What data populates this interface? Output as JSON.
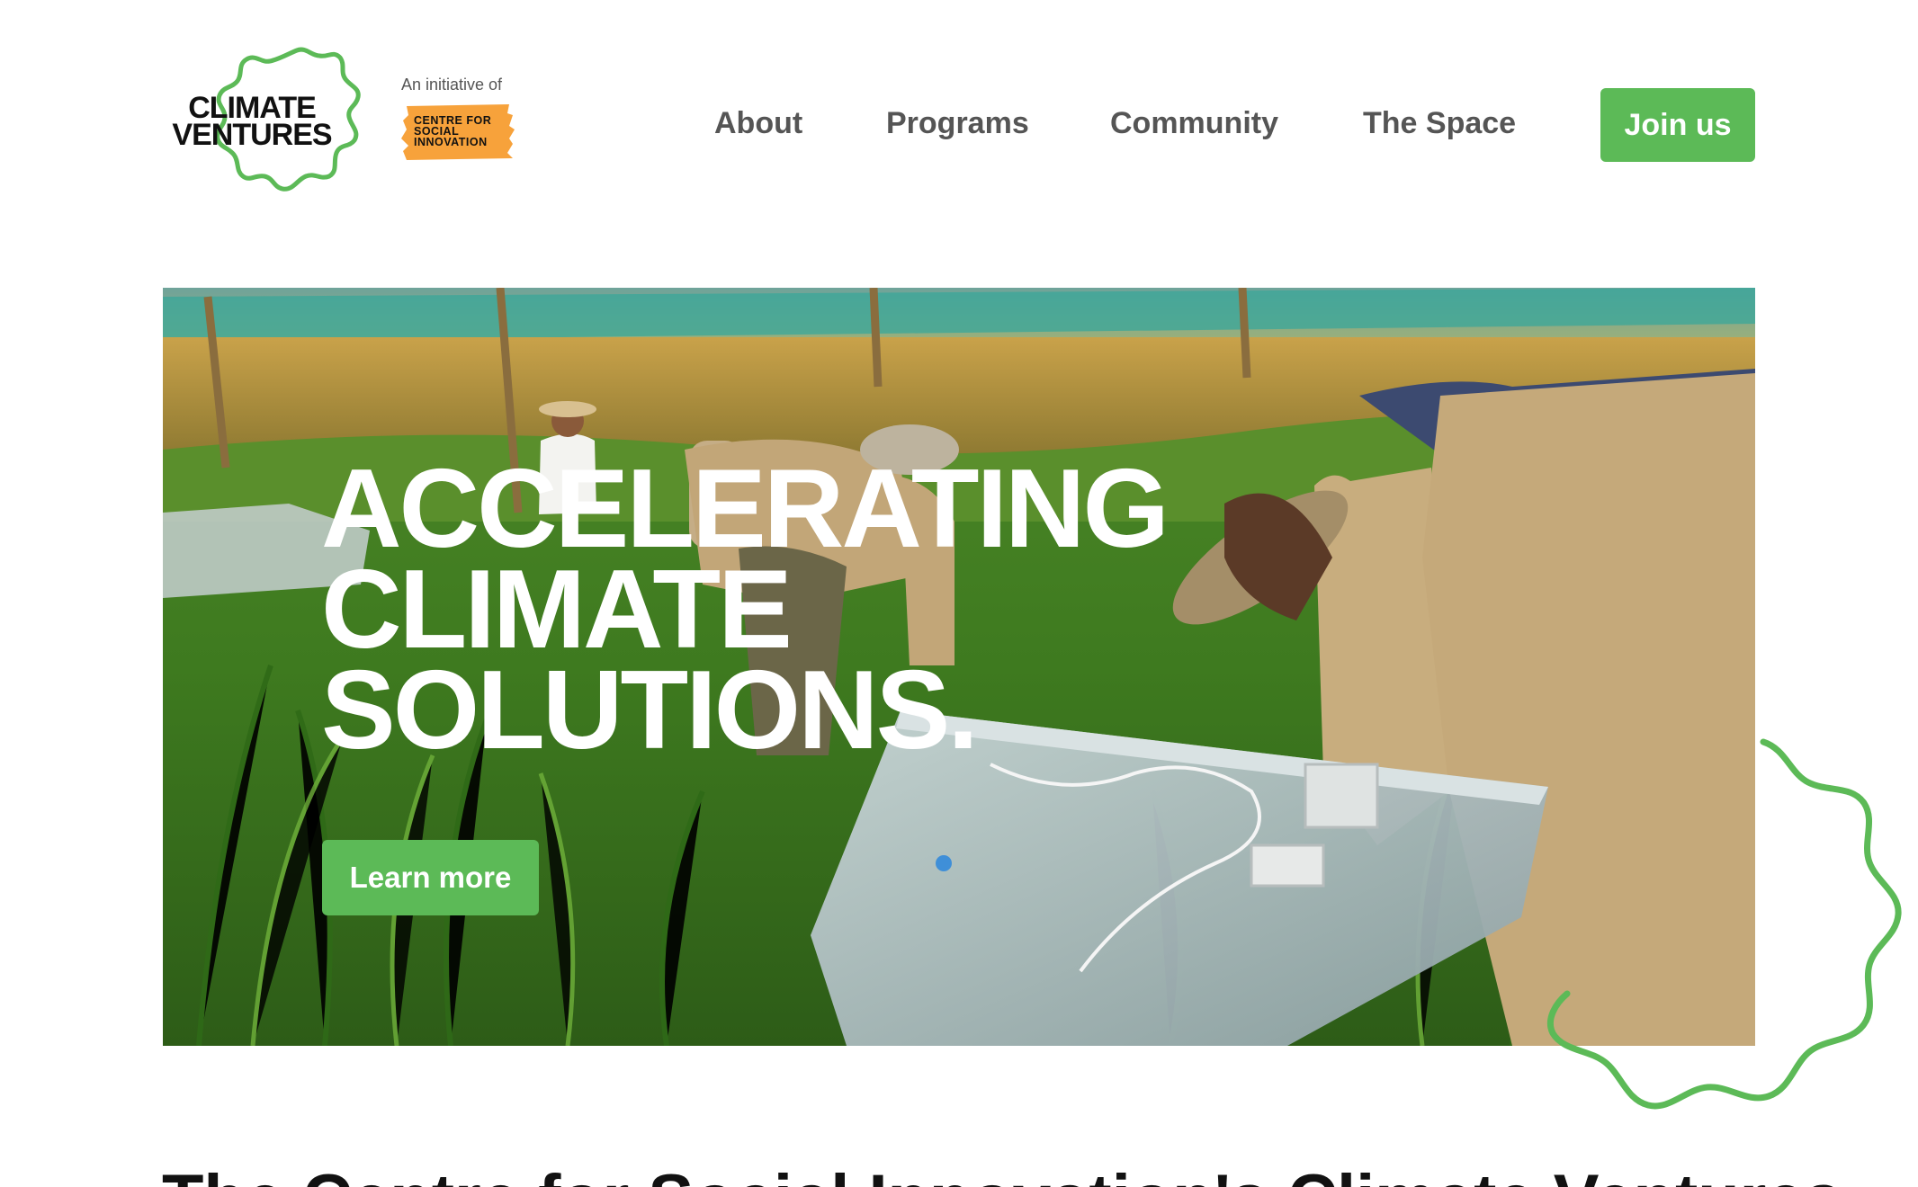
{
  "logo": {
    "line1": "CLIMATE",
    "line2": "VENTURES",
    "icon": "wavy-circle-logo"
  },
  "initiative": {
    "label": "An initiative of",
    "badge_line1": "CENTRE FOR",
    "badge_line2": "SOCIAL",
    "badge_line3": "INNOVATION"
  },
  "nav": {
    "items": [
      {
        "label": "About"
      },
      {
        "label": "Programs"
      },
      {
        "label": "Community"
      },
      {
        "label": "The Space"
      }
    ],
    "cta_label": "Join us"
  },
  "hero": {
    "headline_line1": "ACCELERATING",
    "headline_line2": "CLIMATE",
    "headline_line3": "SOLUTIONS.",
    "button_label": "Learn more"
  },
  "section": {
    "heading": "The Centre for Social Innovation's Climate Ventures"
  },
  "colors": {
    "accent": "#5cba57",
    "nav_text": "#555555",
    "badge_orange": "#f7a23b"
  }
}
